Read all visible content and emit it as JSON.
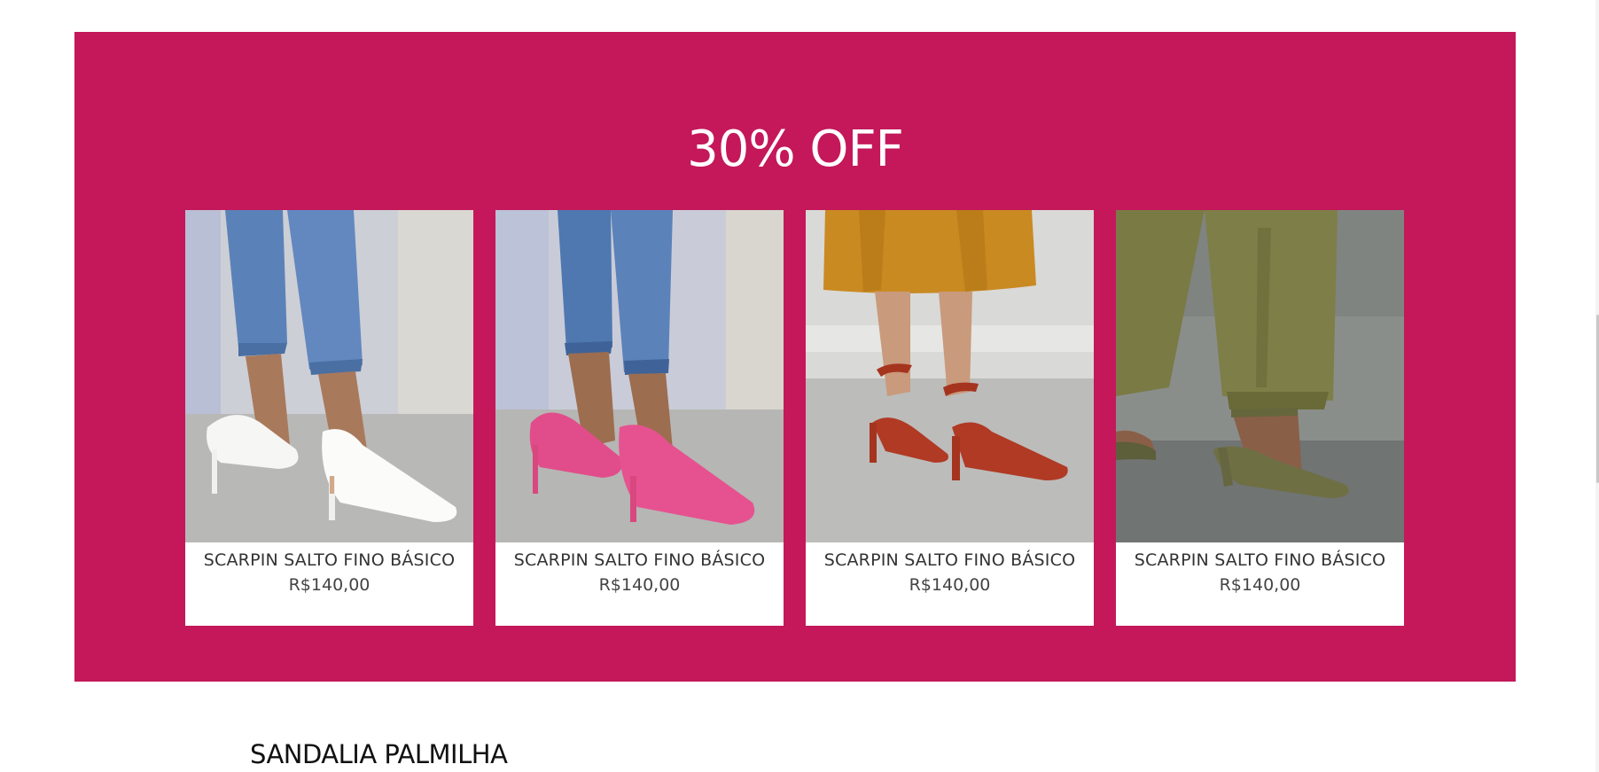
{
  "promo": {
    "title": "30% OFF",
    "background_color": "#c4185a"
  },
  "products": [
    {
      "name": "SCARPIN SALTO FINO BÁSICO",
      "price": "R$140,00",
      "image": "white-pumps-with-jeans"
    },
    {
      "name": "SCARPIN SALTO FINO BÁSICO",
      "price": "R$140,00",
      "image": "pink-pumps-with-jeans"
    },
    {
      "name": "SCARPIN SALTO FINO BÁSICO",
      "price": "R$140,00",
      "image": "rust-strap-sandals-with-mustard-skirt"
    },
    {
      "name": "SCARPIN SALTO FINO BÁSICO",
      "price": "R$140,00",
      "image": "olive-strap-sandals-with-olive-pants"
    }
  ],
  "next_section": {
    "title": "SANDALIA PALMILHA"
  }
}
